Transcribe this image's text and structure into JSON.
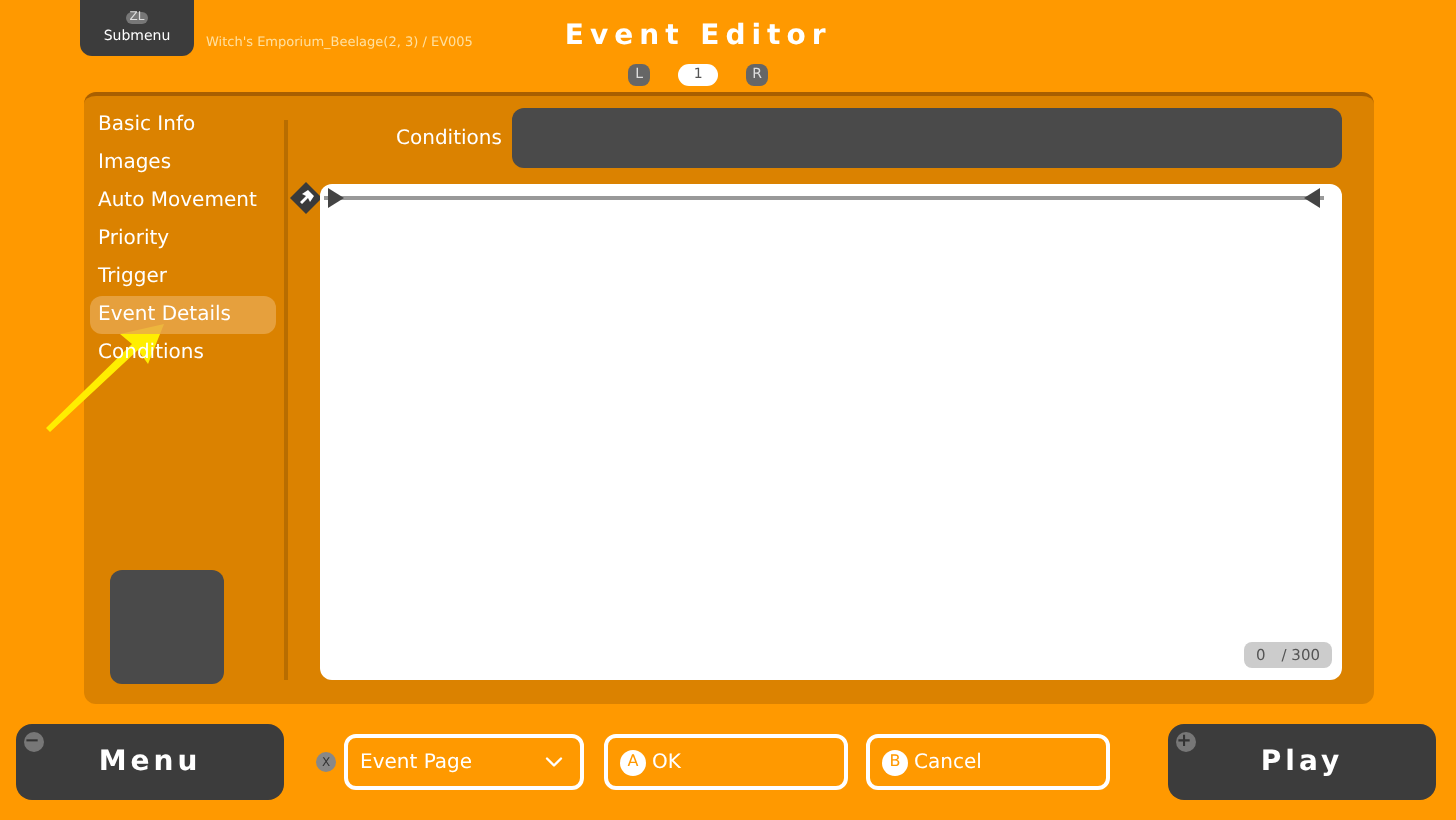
{
  "submenu": {
    "key": "ZL",
    "label": "Submenu"
  },
  "breadcrumb": "Witch's Emporium_Beelage(2, 3) / EV005",
  "title": "Event Editor",
  "pager": [
    {
      "label": "L",
      "kind": "key"
    },
    {
      "label": "1",
      "kind": "page"
    },
    {
      "label": "R",
      "kind": "key"
    }
  ],
  "sidebar": {
    "items": [
      {
        "label": "Basic Info",
        "selected": false
      },
      {
        "label": "Images",
        "selected": false
      },
      {
        "label": "Auto Movement",
        "selected": false
      },
      {
        "label": "Priority",
        "selected": false
      },
      {
        "label": "Trigger",
        "selected": false
      },
      {
        "label": "Event Details",
        "selected": true
      },
      {
        "label": "Conditions",
        "selected": false
      }
    ]
  },
  "conditions": {
    "label": "Conditions"
  },
  "editor": {
    "counter": "0",
    "max": "/ 300"
  },
  "bottom": {
    "menu": {
      "key": "−",
      "label": "Menu"
    },
    "dropdown": {
      "key": "X",
      "value": "Event Page"
    },
    "ok": {
      "key": "A",
      "label": "OK"
    },
    "cancel": {
      "key": "B",
      "label": "Cancel"
    },
    "play": {
      "key": "+",
      "label": "Play"
    }
  }
}
